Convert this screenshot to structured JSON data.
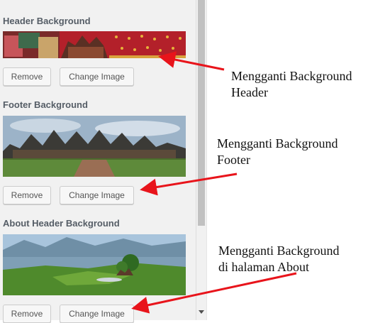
{
  "sections": [
    {
      "title": "Header Background",
      "image_alt": "Minangkabau decorative red textile pattern banner",
      "remove_label": "Remove",
      "change_label": "Change Image"
    },
    {
      "title": "Footer Background",
      "image_alt": "Rumah Gadang traditional Minangkabau palace panorama",
      "remove_label": "Remove",
      "change_label": "Change Image"
    },
    {
      "title": "About Header Background",
      "image_alt": "Lake Maninjau landscape with green rice fields",
      "remove_label": "Remove",
      "change_label": "Change Image"
    }
  ],
  "annotations": [
    {
      "line1": "Mengganti Background",
      "line2": "Header"
    },
    {
      "line1": "Mengganti Background",
      "line2": "Footer"
    },
    {
      "line1": "Mengganti Background",
      "line2": "di halaman About"
    }
  ],
  "colors": {
    "arrow": "#e8141b",
    "panel_bg": "#f1f1f1",
    "section_title": "#555d66",
    "button_bg": "#f7f7f7"
  }
}
